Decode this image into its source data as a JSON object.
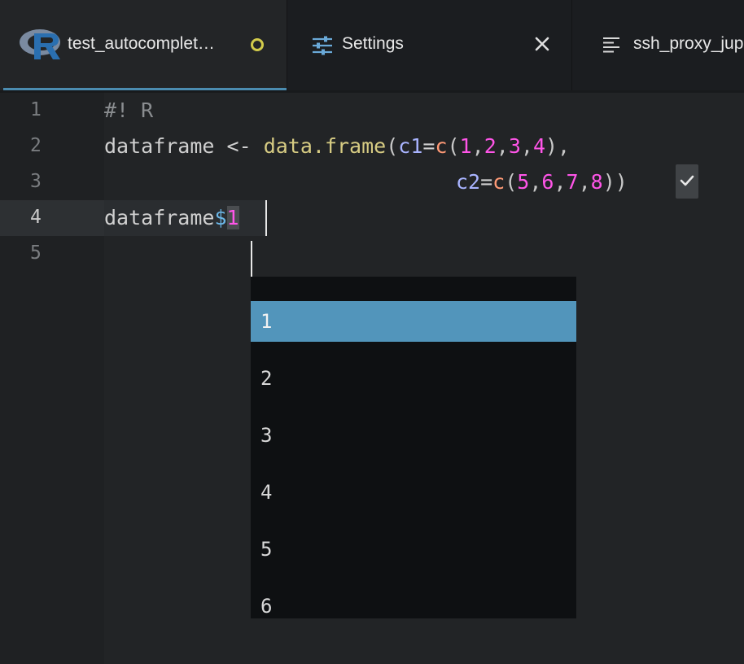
{
  "tabs": [
    {
      "label": "test_autocomplet…",
      "icon": "r-logo-icon",
      "modified": true,
      "active": true
    },
    {
      "label": "Settings",
      "icon": "sliders-icon",
      "closable": true
    },
    {
      "label": "ssh_proxy_jup",
      "icon": "lines-icon"
    }
  ],
  "editor": {
    "line_numbers": [
      "1",
      "2",
      "3",
      "4",
      "5"
    ],
    "current_line": "4",
    "code": {
      "l1": {
        "comment": "#! R"
      },
      "l2": {
        "ident": "dataframe",
        "assign": " <- ",
        "func": "data.frame",
        "open": "(",
        "arg": "c1",
        "eq": "=",
        "call": "c",
        "p_open": "(",
        "n1": "1",
        "c1": ",",
        "n2": "2",
        "c2": ",",
        "n3": "3",
        "c3": ",",
        "n4": "4",
        "p_close": "),"
      },
      "l3": {
        "arg": "c2",
        "eq": "=",
        "call": "c",
        "p_open": "(",
        "n1": "5",
        "c1": ",",
        "n2": "6",
        "c2": ",",
        "n3": "7",
        "c3": ",",
        "n4": "8",
        "p_close": "))"
      },
      "l4": {
        "ident": "dataframe",
        "dollar": "$",
        "typed": "1"
      }
    }
  },
  "autocomplete": {
    "items": [
      "1",
      "2",
      "3",
      "4",
      "5",
      "6"
    ],
    "selected": "1"
  },
  "colors": {
    "accent": "#4b8cb0",
    "selected_item": "#5295bb",
    "modified_dot": "#d2cb4b",
    "number": "#ff55e8",
    "function": "#d7cc83"
  }
}
